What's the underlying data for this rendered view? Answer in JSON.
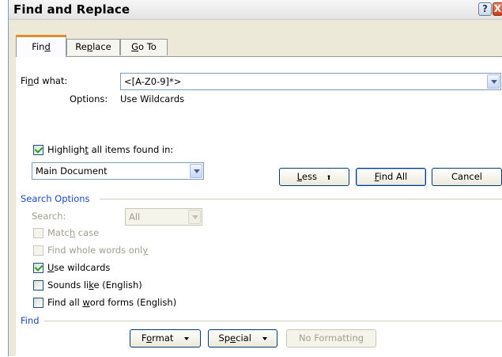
{
  "window": {
    "title": "Find and Replace",
    "help_glyph": "?",
    "close_glyph": "X"
  },
  "tabs": [
    {
      "label_pre": "Fin",
      "mnemonic": "d",
      "label_post": "",
      "active": true
    },
    {
      "label_pre": "Re",
      "mnemonic": "p",
      "label_post": "lace",
      "active": false
    },
    {
      "label_pre": "",
      "mnemonic": "G",
      "label_post": "o To",
      "active": false
    }
  ],
  "find": {
    "label_pre": "Fi",
    "label_mnemonic": "n",
    "label_post": "d what:",
    "value": "<[A-Z0-9]*>",
    "options_label": "Options:",
    "options_value": "Use Wildcards"
  },
  "highlight": {
    "checked": true,
    "label_pre": "Highligh",
    "label_mnemonic": "t",
    "label_post": " all items found in:",
    "scope": "Main Document"
  },
  "buttons": {
    "less_pre": "",
    "less_mnemonic": "L",
    "less_post": "ess",
    "less_arrow": "⬆",
    "find_all_pre": "",
    "find_all_mnemonic": "F",
    "find_all_post": "ind All",
    "cancel": "Cancel"
  },
  "search_options": {
    "heading": "Search Options",
    "search_label": "Search:",
    "search_value": "All",
    "options": [
      {
        "name": "match-case",
        "pre": "Matc",
        "mn": "h",
        "post": " case",
        "checked": false,
        "enabled": false
      },
      {
        "name": "find-whole-words",
        "pre": "Find whole words onl",
        "mn": "y",
        "post": "",
        "checked": false,
        "enabled": false
      },
      {
        "name": "use-wildcards",
        "pre": "",
        "mn": "U",
        "post": "se wildcards",
        "checked": true,
        "enabled": true
      },
      {
        "name": "sounds-like",
        "pre": "Sounds li",
        "mn": "k",
        "post": "e (English)",
        "checked": false,
        "enabled": true
      },
      {
        "name": "find-all-word-forms",
        "pre": "Find all ",
        "mn": "w",
        "post": "ord forms (English)",
        "checked": false,
        "enabled": true
      }
    ]
  },
  "find_section": {
    "heading": "Find",
    "format_pre": "F",
    "format_mnemonic": "o",
    "format_post": "rmat",
    "special_pre": "Sp",
    "special_mnemonic": "e",
    "special_post": "cial",
    "no_formatting": "No Formatting"
  },
  "colors": {
    "section_heading": "#1c47c8",
    "dialog_bg": "#ece9d8",
    "tab_accent": "#e68b2c"
  }
}
